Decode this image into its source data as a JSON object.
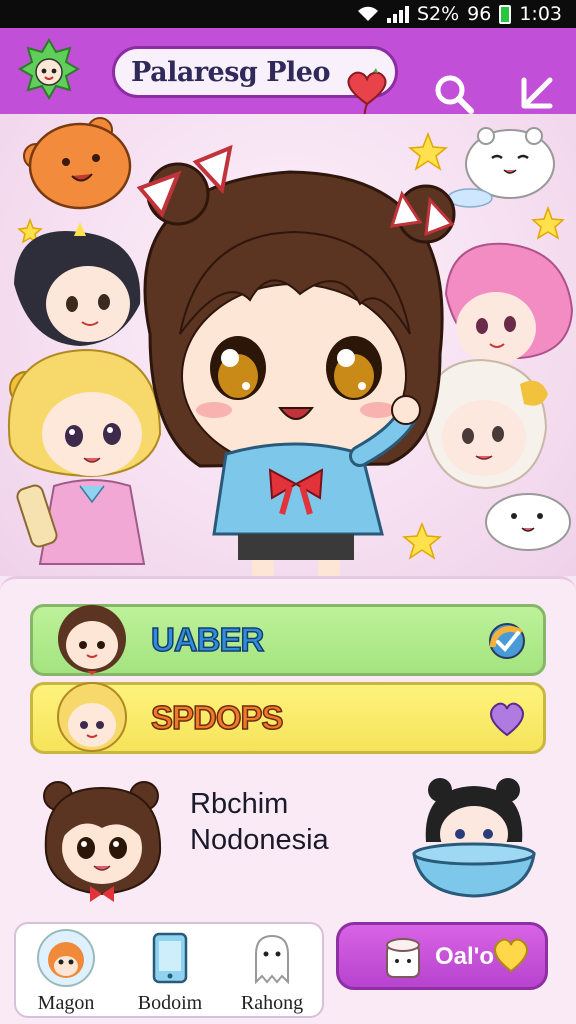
{
  "status_bar": {
    "carrier": "S2%",
    "signal_label": "96",
    "time": "1:03"
  },
  "header": {
    "title": "Palaresg Pleo"
  },
  "cards": [
    {
      "label": "UABER"
    },
    {
      "label": "SPDOPS"
    }
  ],
  "info": {
    "line1": "Rbchim",
    "line2": "Nodonesia"
  },
  "nav": {
    "items": [
      {
        "label": "Magon"
      },
      {
        "label": "Bodoim"
      },
      {
        "label": "Rahong"
      }
    ],
    "cta_label": "Oal'o"
  },
  "colors": {
    "appbar": "#c24fd8",
    "panel": "#f9eaf6",
    "green_card": "#a4e47f",
    "yellow_card": "#f6e35a",
    "cta": "#c24fd8"
  }
}
